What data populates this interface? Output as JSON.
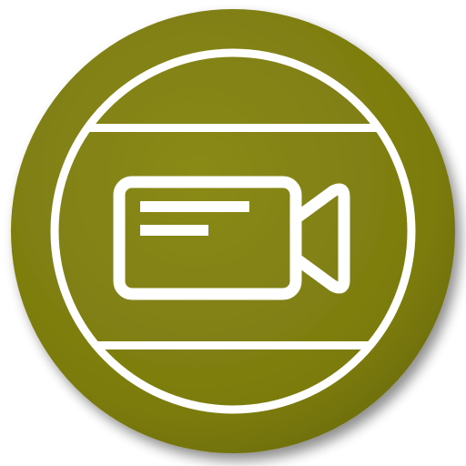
{
  "icon": {
    "name": "video-camera-icon",
    "accent_color": "#7f7f12",
    "accent_dark": "#5f5f0c",
    "stroke_color": "#ffffff",
    "background_color": "#ffffff"
  }
}
